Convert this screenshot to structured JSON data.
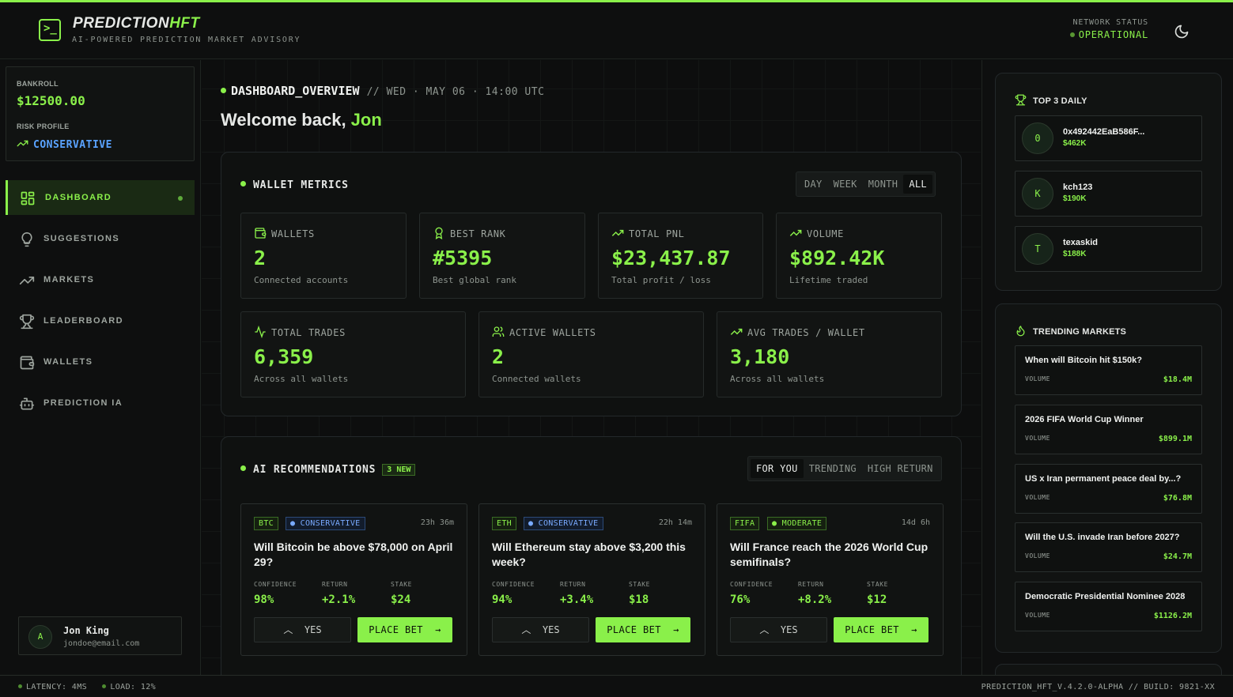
{
  "app": {
    "brand_part1": "PREDICTION",
    "brand_part2": "HFT",
    "tagline": "AI-POWERED PREDICTION MARKET ADVISORY",
    "network_status_label": "NETWORK STATUS",
    "network_status_value": "OPERATIONAL",
    "accent_color": "#8af04a"
  },
  "sidebar": {
    "bankroll_label": "BANKROLL",
    "bankroll_value": "$12500.00",
    "risk_label": "RISK PROFILE",
    "risk_value": "CONSERVATIVE",
    "items": [
      {
        "label": "DASHBOARD",
        "icon": "dashboard-icon",
        "active": true
      },
      {
        "label": "SUGGESTIONS",
        "icon": "lightbulb-icon"
      },
      {
        "label": "MARKETS",
        "icon": "trending-up-icon"
      },
      {
        "label": "LEADERBOARD",
        "icon": "trophy-icon"
      },
      {
        "label": "WALLETS",
        "icon": "wallet-icon"
      },
      {
        "label": "PREDICTION IA",
        "icon": "bot-icon"
      }
    ],
    "user": {
      "initial": "A",
      "name": "Jon King",
      "email": "jondoe@email.com"
    }
  },
  "main": {
    "breadcrumb_title": "DASHBOARD_OVERVIEW",
    "breadcrumb_sub": "// WED · MAY 06 · 14:00 UTC",
    "welcome_prefix": "Welcome back, ",
    "welcome_name": "Jon",
    "wallet_metrics": {
      "title": "WALLET METRICS",
      "ranges": [
        "DAY",
        "WEEK",
        "MONTH",
        "ALL"
      ],
      "selected_range": "ALL",
      "cards": [
        {
          "label": "WALLETS",
          "value": "2",
          "sub": "Connected accounts",
          "icon": "wallet-icon"
        },
        {
          "label": "BEST RANK",
          "value": "#5395",
          "sub": "Best global rank",
          "icon": "award-icon"
        },
        {
          "label": "TOTAL PNL",
          "value": "$23,437.87",
          "sub": "Total profit / loss",
          "icon": "trending-up-icon"
        },
        {
          "label": "VOLUME",
          "value": "$892.42K",
          "sub": "Lifetime traded",
          "icon": "trending-up-icon"
        },
        {
          "label": "TOTAL TRADES",
          "value": "6,359",
          "sub": "Across all wallets",
          "icon": "activity-icon"
        },
        {
          "label": "ACTIVE WALLETS",
          "value": "2",
          "sub": "Connected wallets",
          "icon": "users-icon"
        },
        {
          "label": "AVG TRADES / WALLET",
          "value": "3,180",
          "sub": "Across all wallets",
          "icon": "trending-up-icon"
        }
      ]
    },
    "recommendations": {
      "title": "AI RECOMMENDATIONS",
      "badge": "3 NEW",
      "tabs": [
        "FOR YOU",
        "TRENDING",
        "HIGH RETURN"
      ],
      "selected_tab": "FOR YOU",
      "metric_labels": [
        "CONFIDENCE",
        "RETURN",
        "STAKE"
      ],
      "yes_label": "YES",
      "bet_label": "PLACE BET",
      "items": [
        {
          "asset": "BTC",
          "risk": "CONSERVATIVE",
          "time": "23h 36m",
          "question": "Will Bitcoin be above $78,000 on April 29?",
          "confidence": "98%",
          "return": "+2.1%",
          "stake": "$24"
        },
        {
          "asset": "ETH",
          "risk": "CONSERVATIVE",
          "time": "22h 14m",
          "question": "Will Ethereum stay above $3,200 this week?",
          "confidence": "94%",
          "return": "+3.4%",
          "stake": "$18"
        },
        {
          "asset": "FIFA",
          "risk": "MODERATE",
          "time": "14d 6h",
          "question": "Will France reach the 2026 World Cup semifinals?",
          "confidence": "76%",
          "return": "+8.2%",
          "stake": "$12"
        }
      ]
    }
  },
  "right": {
    "top_title": "TOP 3 DAILY",
    "top": [
      {
        "initial": "0",
        "name": "0x492442EaB586F...",
        "amount": "$462K"
      },
      {
        "initial": "K",
        "name": "kch123",
        "amount": "$190K"
      },
      {
        "initial": "T",
        "name": "texaskid",
        "amount": "$188K"
      }
    ],
    "trending_title": "TRENDING MARKETS",
    "volume_label": "VOLUME",
    "markets": [
      {
        "title": "When will Bitcoin hit $150k?",
        "volume": "$18.4M"
      },
      {
        "title": "2026 FIFA World Cup Winner",
        "volume": "$899.1M"
      },
      {
        "title": "US x Iran permanent peace deal by...?",
        "volume": "$76.8M"
      },
      {
        "title": "Will the U.S. invade Iran before 2027?",
        "volume": "$24.7M"
      },
      {
        "title": "Democratic Presidential Nominee 2028",
        "volume": "$1126.2M"
      }
    ]
  },
  "footer": {
    "latency": "LATENCY: 4MS",
    "load": "LOAD: 12%",
    "build": "PREDICTION_HFT_V.4.2.0-ALPHA // BUILD: 9821-XX"
  }
}
